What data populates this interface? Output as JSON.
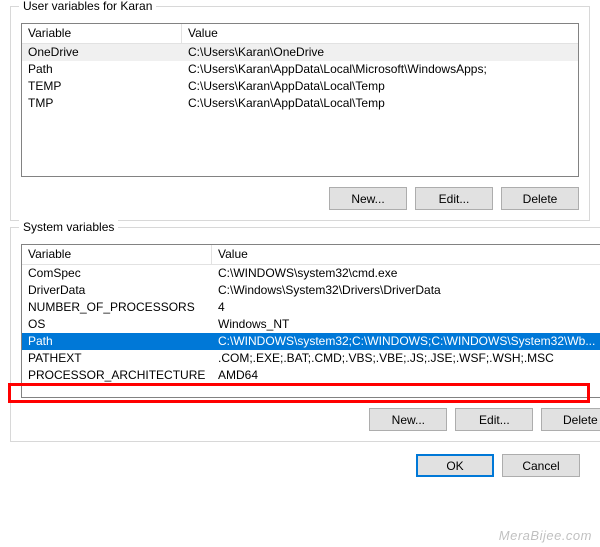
{
  "user_group": {
    "title": "User variables for Karan",
    "header_variable": "Variable",
    "header_value": "Value",
    "rows": [
      {
        "name": "OneDrive",
        "value": "C:\\Users\\Karan\\OneDrive"
      },
      {
        "name": "Path",
        "value": "C:\\Users\\Karan\\AppData\\Local\\Microsoft\\WindowsApps;"
      },
      {
        "name": "TEMP",
        "value": "C:\\Users\\Karan\\AppData\\Local\\Temp"
      },
      {
        "name": "TMP",
        "value": "C:\\Users\\Karan\\AppData\\Local\\Temp"
      }
    ],
    "buttons": {
      "new": "New...",
      "edit": "Edit...",
      "delete": "Delete"
    }
  },
  "sys_group": {
    "title": "System variables",
    "header_variable": "Variable",
    "header_value": "Value",
    "rows": [
      {
        "name": "ComSpec",
        "value": "C:\\WINDOWS\\system32\\cmd.exe"
      },
      {
        "name": "DriverData",
        "value": "C:\\Windows\\System32\\Drivers\\DriverData"
      },
      {
        "name": "NUMBER_OF_PROCESSORS",
        "value": "4"
      },
      {
        "name": "OS",
        "value": "Windows_NT"
      },
      {
        "name": "Path",
        "value": "C:\\WINDOWS\\system32;C:\\WINDOWS;C:\\WINDOWS\\System32\\Wb..."
      },
      {
        "name": "PATHEXT",
        "value": ".COM;.EXE;.BAT;.CMD;.VBS;.VBE;.JS;.JSE;.WSF;.WSH;.MSC"
      },
      {
        "name": "PROCESSOR_ARCHITECTURE",
        "value": "AMD64"
      }
    ],
    "buttons": {
      "new": "New...",
      "edit": "Edit...",
      "delete": "Delete"
    }
  },
  "dialog_buttons": {
    "ok": "OK",
    "cancel": "Cancel"
  },
  "watermark": "MeraBijee.com"
}
